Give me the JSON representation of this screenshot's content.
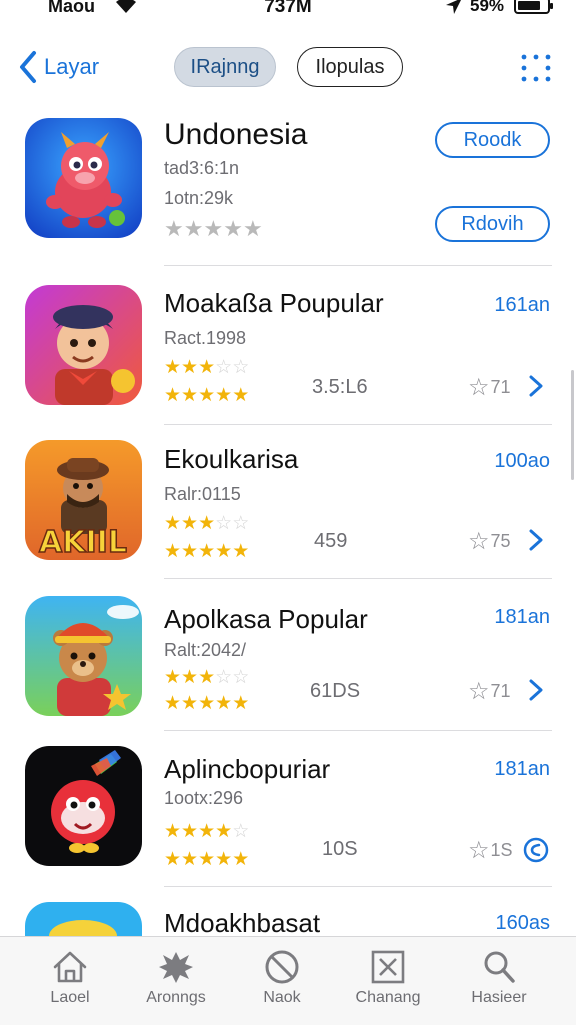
{
  "status_bar": {
    "carrier": "Maou",
    "time": "737M",
    "battery": "59%"
  },
  "nav": {
    "back_label": "Layar",
    "segments": [
      {
        "label": "IRajnng",
        "selected": true
      },
      {
        "label": "Ilopulas",
        "selected": false
      }
    ]
  },
  "featured": {
    "name": "Undonesia",
    "meta1": "tad3:6:1n",
    "meta2": "1otn:29k",
    "rating_stars": 5,
    "primary_button": "Roodk",
    "secondary_button": "Rdovih"
  },
  "apps": [
    {
      "name": "Moakaßa Poupular",
      "meta": "Ract.1998",
      "rating_row1": 2.5,
      "rating_row2": 5,
      "score": "3.5:L6",
      "size": "161an",
      "favorites": "71"
    },
    {
      "name": "Ekoulkarisa",
      "meta": "Ralr:0115",
      "rating_row1": 2.5,
      "rating_row2": 4.5,
      "score": "459",
      "size": "100ao",
      "favorites": "75"
    },
    {
      "name": "Apolkasa Popular",
      "meta": "Ralt:2042/",
      "rating_row1": 2.5,
      "rating_row2": 5,
      "score": "61DS",
      "size": "181an",
      "favorites": "71"
    },
    {
      "name": "Aplincbopuriar",
      "meta": "1ootx:296",
      "rating_row1": 4,
      "rating_row2": 5,
      "score": "10S",
      "size": "181an",
      "favorites": "1S"
    }
  ],
  "partial_app": {
    "name": "Mdoakhbasat",
    "size": "160as"
  },
  "tabs": [
    {
      "label": "Laoel",
      "icon": "home-icon"
    },
    {
      "label": "Aronngs",
      "icon": "splat-icon"
    },
    {
      "label": "Naok",
      "icon": "prohibited-icon"
    },
    {
      "label": "Chanang",
      "icon": "close-box-icon"
    },
    {
      "label": "Hasieer",
      "icon": "search-icon"
    }
  ],
  "colors": {
    "accent": "#1a73d9",
    "star": "#f2b40a",
    "segment_selected": "#d3dae3"
  }
}
